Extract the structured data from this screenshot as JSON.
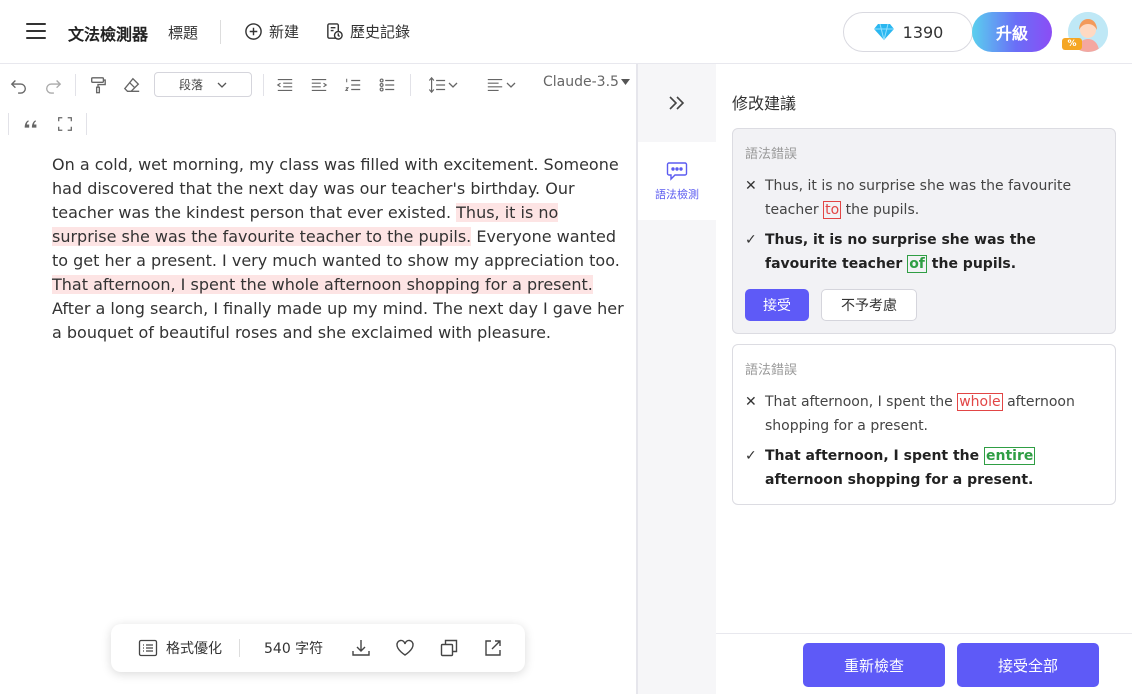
{
  "header": {
    "app_title": "文法檢測器",
    "doc_title": "標題",
    "new_label": "新建",
    "history_label": "歷史記錄",
    "credits": "1390",
    "upgrade_label": "升級",
    "avatar_badge": "%"
  },
  "toolbar": {
    "paragraph_select": "段落",
    "model_select": "Claude-3.5"
  },
  "editor": {
    "segments": [
      {
        "text": "On a cold, wet morning, my class was filled with excitement. Someone had discovered that the next day was our teacher's birthday. Our teacher was the kindest person that ever existed. ",
        "highlight": false
      },
      {
        "text": "Thus, it is no surprise she was the favourite teacher to the pupils.",
        "highlight": true
      },
      {
        "text": " Everyone wanted to get her a present. I very much wanted to show my appreciation too. ",
        "highlight": false
      },
      {
        "text": "That afternoon, I spent the whole afternoon shopping for a present.",
        "highlight": true
      },
      {
        "text": " After a long search, I finally made up my mind. The next day I gave her a bouquet of beautiful roses and she exclaimed with pleasure.",
        "highlight": false
      }
    ]
  },
  "bottom_bar": {
    "format_label": "格式優化",
    "char_count": "540 字符"
  },
  "rail": {
    "tab_label": "語法檢測"
  },
  "panel": {
    "title": "修改建議",
    "suggestions": [
      {
        "type": "語法錯誤",
        "original": {
          "before": "Thus, it is no surprise she was the favourite teacher ",
          "word": "to",
          "after": " the pupils."
        },
        "corrected": {
          "before": "Thus, it is no surprise she was the favourite teacher ",
          "word": "of",
          "after": " the pupils."
        },
        "accept_label": "接受",
        "ignore_label": "不予考慮"
      },
      {
        "type": "語法錯誤",
        "original": {
          "before": "That afternoon, I spent the ",
          "word": "whole",
          "after": " afternoon shopping for a present."
        },
        "corrected": {
          "before": "That afternoon, I spent the ",
          "word": "entire",
          "after": " afternoon shopping for a present."
        }
      }
    ],
    "recheck_label": "重新檢查",
    "accept_all_label": "接受全部"
  },
  "colors": {
    "accent": "#5e5af7",
    "highlight": "#fde4e4",
    "error": "#e24545",
    "correct": "#2f9e44"
  },
  "icons": [
    "hamburger-icon",
    "plus-circle-icon",
    "history-icon",
    "diamond-icon",
    "undo-icon",
    "redo-icon",
    "format-painter-icon",
    "eraser-icon",
    "outdent-icon",
    "indent-icon",
    "ordered-list-icon",
    "unordered-list-icon",
    "line-height-icon",
    "align-icon",
    "quote-icon",
    "fullscreen-icon",
    "double-chevron-right-icon",
    "grammar-check-icon",
    "list-format-icon",
    "download-icon",
    "heart-icon",
    "copy-icon",
    "share-icon"
  ]
}
